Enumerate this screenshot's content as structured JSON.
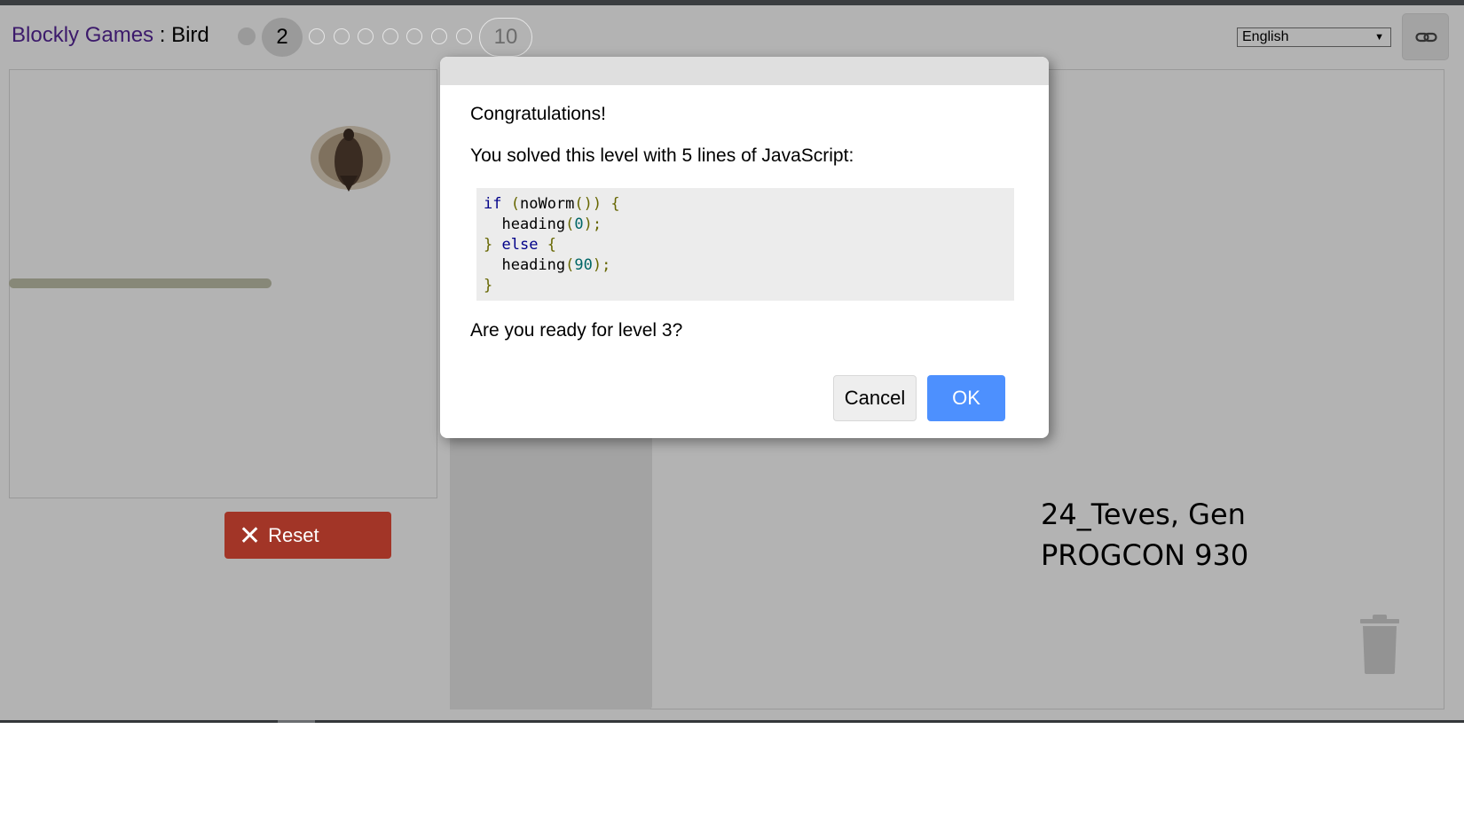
{
  "header": {
    "site_title": "Blockly Games",
    "separator": " : ",
    "game_name": "Bird",
    "levels": {
      "current_level_label": "2",
      "last_level_label": "10",
      "solved_levels": [
        1
      ],
      "total_levels": 10
    },
    "language_select": {
      "selected": "English",
      "arrow": "▼"
    },
    "link_button_icon": "link-icon"
  },
  "game": {
    "reset_label": "Reset",
    "reset_icon": "close-icon",
    "bird_icon": "bird-icon",
    "trash_icon": "trash-icon"
  },
  "dialog": {
    "congrats": "Congratulations!",
    "solved_message": "You solved this level with 5 lines of JavaScript:",
    "code_lines": [
      "if (noWorm()) {",
      "  heading(0);",
      "} else {",
      "  heading(90);",
      "}"
    ],
    "ready_question": "Are you ready for level 3?",
    "cancel_label": "Cancel",
    "ok_label": "OK"
  },
  "watermark": {
    "line1": "24_Teves, Gen",
    "line2": "PROGCON 930"
  },
  "colors": {
    "overlay_gray": "#b3b3b3",
    "reset_red": "#a23527",
    "ok_blue": "#4d90fe",
    "title_purple": "#3c1a6b"
  }
}
